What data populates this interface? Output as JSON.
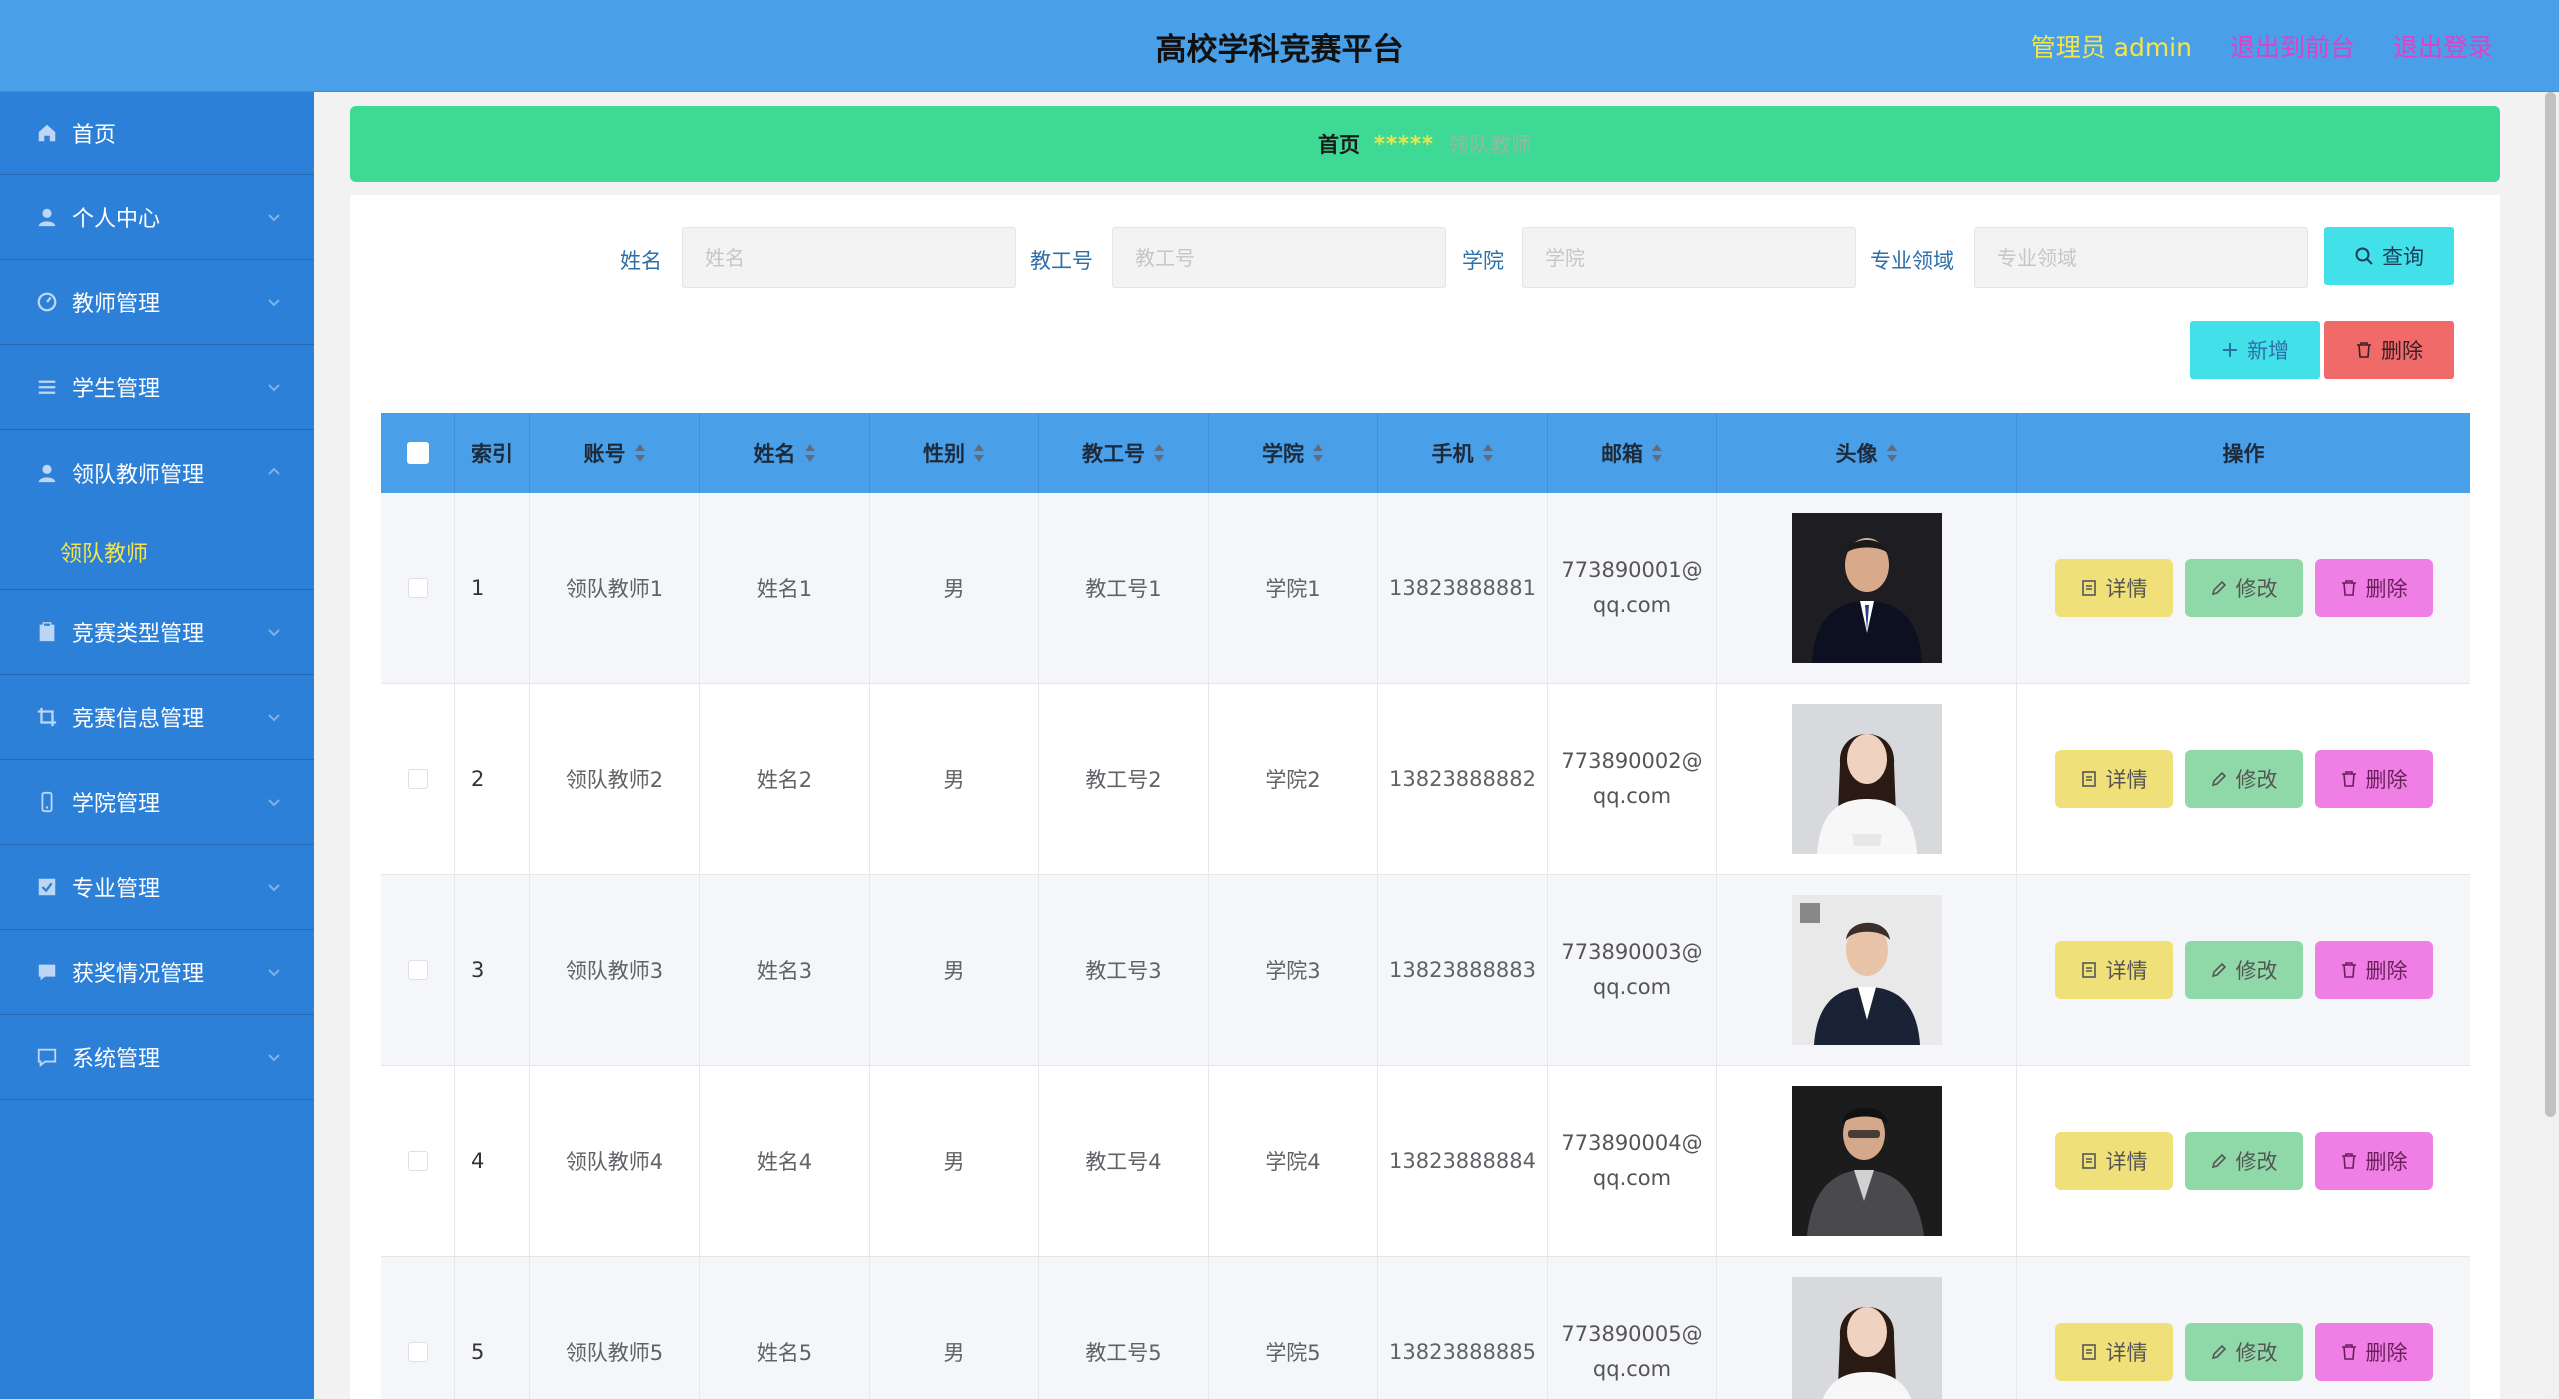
{
  "header": {
    "title": "高校学科竞赛平台",
    "admin": "管理员 admin",
    "to_front": "退出到前台",
    "logout": "退出登录"
  },
  "sidebar": {
    "items": [
      {
        "label": "首页",
        "icon": "home-icon"
      },
      {
        "label": "个人中心",
        "icon": "user-icon"
      },
      {
        "label": "教师管理",
        "icon": "dashboard-icon"
      },
      {
        "label": "学生管理",
        "icon": "list-icon"
      },
      {
        "label": "领队教师管理",
        "icon": "user-icon"
      },
      {
        "label": "竞赛类型管理",
        "icon": "clipboard-icon"
      },
      {
        "label": "竞赛信息管理",
        "icon": "crop-icon"
      },
      {
        "label": "学院管理",
        "icon": "phone-icon"
      },
      {
        "label": "专业管理",
        "icon": "check-square-icon"
      },
      {
        "label": "获奖情况管理",
        "icon": "chat-icon"
      },
      {
        "label": "系统管理",
        "icon": "message-icon"
      }
    ],
    "sub_item": "领队教师"
  },
  "breadcrumb": {
    "home": "首页",
    "separator": "*****",
    "current": "领队教师"
  },
  "search": {
    "fields": [
      {
        "label": "姓名",
        "placeholder": "姓名"
      },
      {
        "label": "教工号",
        "placeholder": "教工号"
      },
      {
        "label": "学院",
        "placeholder": "学院"
      },
      {
        "label": "专业领域",
        "placeholder": "专业领域"
      }
    ],
    "query_label": "查询"
  },
  "toolbar": {
    "add_label": "新增",
    "delete_label": "删除"
  },
  "table": {
    "columns": [
      "索引",
      "账号",
      "姓名",
      "性别",
      "教工号",
      "学院",
      "手机",
      "邮箱",
      "头像",
      "操作"
    ],
    "rows": [
      {
        "index": "1",
        "account": "领队教师1",
        "name": "姓名1",
        "gender": "男",
        "staff_no": "教工号1",
        "college": "学院1",
        "phone": "13823888881",
        "email_a": "773890001@",
        "email_b": "qq.com"
      },
      {
        "index": "2",
        "account": "领队教师2",
        "name": "姓名2",
        "gender": "男",
        "staff_no": "教工号2",
        "college": "学院2",
        "phone": "13823888882",
        "email_a": "773890002@",
        "email_b": "qq.com"
      },
      {
        "index": "3",
        "account": "领队教师3",
        "name": "姓名3",
        "gender": "男",
        "staff_no": "教工号3",
        "college": "学院3",
        "phone": "13823888883",
        "email_a": "773890003@",
        "email_b": "qq.com"
      },
      {
        "index": "4",
        "account": "领队教师4",
        "name": "姓名4",
        "gender": "男",
        "staff_no": "教工号4",
        "college": "学院4",
        "phone": "13823888884",
        "email_a": "773890004@",
        "email_b": "qq.com"
      },
      {
        "index": "5",
        "account": "领队教师5",
        "name": "姓名5",
        "gender": "男",
        "staff_no": "教工号5",
        "college": "学院5",
        "phone": "13823888885",
        "email_a": "773890005@",
        "email_b": "qq.com"
      }
    ],
    "actions": {
      "detail": "详情",
      "edit": "修改",
      "remove": "删除"
    }
  },
  "colors": {
    "header_bg": "#4aa0e8",
    "sidebar_bg": "#2d80d8",
    "breadcrumb_bg": "#3dd995",
    "accent_yellow": "#f5e44a",
    "link_magenta": "#e040c8"
  }
}
